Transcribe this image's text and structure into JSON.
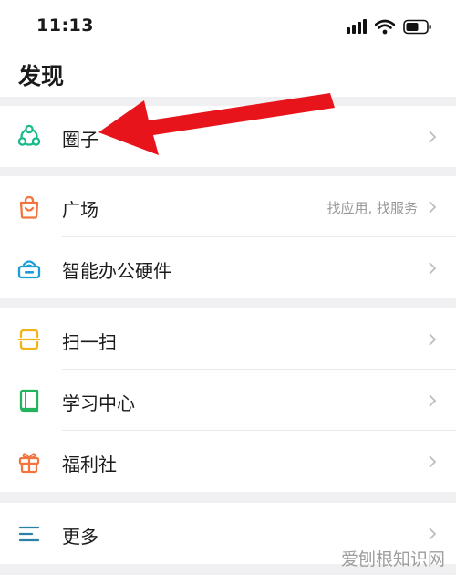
{
  "status_bar": {
    "time": "11:13",
    "icons": [
      "signal-icon",
      "wifi-icon",
      "battery-icon"
    ]
  },
  "header": {
    "title": "发现"
  },
  "groups": [
    {
      "items": [
        {
          "label": "圈子",
          "icon": "circle-group-icon",
          "color": "#19b98a",
          "hint": ""
        }
      ]
    },
    {
      "items": [
        {
          "label": "广场",
          "icon": "shopping-bag-icon",
          "color": "#f2743e",
          "hint": "找应用, 找服务"
        },
        {
          "label": "智能办公硬件",
          "icon": "office-device-icon",
          "color": "#1a9ed8",
          "hint": ""
        }
      ]
    },
    {
      "items": [
        {
          "label": "扫一扫",
          "icon": "scan-icon",
          "color": "#f2b219",
          "hint": ""
        },
        {
          "label": "学习中心",
          "icon": "book-icon",
          "color": "#22b45c",
          "hint": ""
        },
        {
          "label": "福利社",
          "icon": "gift-icon",
          "color": "#f2743e",
          "hint": ""
        }
      ]
    },
    {
      "items": [
        {
          "label": "更多",
          "icon": "menu-lines-icon",
          "color": "#2c7fa6",
          "hint": ""
        }
      ]
    }
  ],
  "annotation": {
    "arrow_color": "#e8141c"
  },
  "watermark": {
    "text": "爱刨根知识网"
  }
}
